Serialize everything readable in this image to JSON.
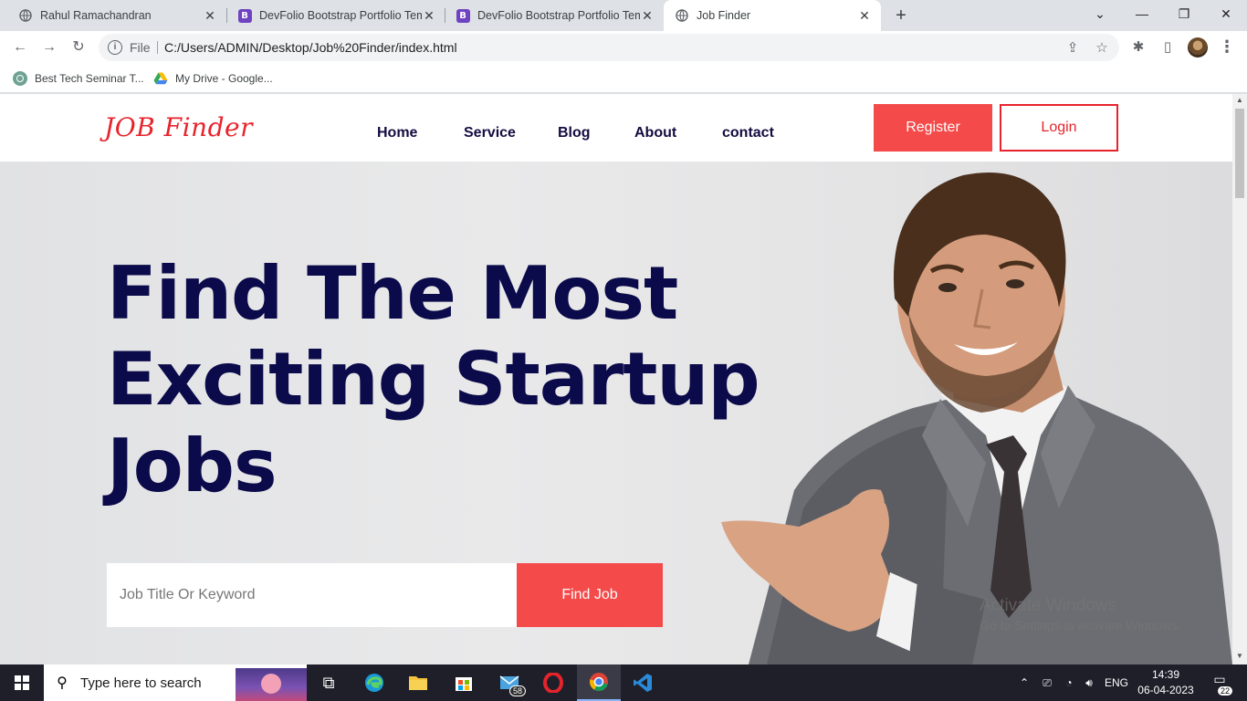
{
  "browser": {
    "tabs": [
      {
        "title": "Rahul Ramachandran",
        "favicon": "globe-icon",
        "active": false
      },
      {
        "title": "DevFolio Bootstrap Portfolio Tem",
        "favicon": "bootstrap-icon",
        "active": false
      },
      {
        "title": "DevFolio Bootstrap Portfolio Tem",
        "favicon": "bootstrap-icon",
        "active": false
      },
      {
        "title": "Job Finder",
        "favicon": "globe-icon",
        "active": true
      }
    ],
    "favicon_letter": "B",
    "address_label": "File",
    "url": "C:/Users/ADMIN/Desktop/Job%20Finder/index.html",
    "bookmarks": [
      {
        "label": "Best Tech Seminar T...",
        "icon": "chatgpt-icon"
      },
      {
        "label": "My Drive - Google...",
        "icon": "google-drive-icon"
      }
    ]
  },
  "site": {
    "logo": "JOB Finder",
    "nav": [
      "Home",
      "Service",
      "Blog",
      "About",
      "contact"
    ],
    "register_label": "Register",
    "login_label": "Login",
    "hero_lines": [
      "Find The Most",
      "Exciting Startup",
      "Jobs"
    ],
    "search_placeholder": "Job Title Or Keyword",
    "find_button": "Find Job",
    "watermark_title": "Activate Windows",
    "watermark_sub": "Go to Settings to activate Windows.",
    "colors": {
      "accent": "#f44a4a",
      "logo": "#e8232c",
      "heading": "#0b0a4a",
      "nav": "#140c40"
    }
  },
  "taskbar": {
    "search_text": "Type here to search",
    "mail_badge": "58",
    "language": "ENG",
    "time": "14:39",
    "date": "06-04-2023",
    "notifications": "22"
  }
}
